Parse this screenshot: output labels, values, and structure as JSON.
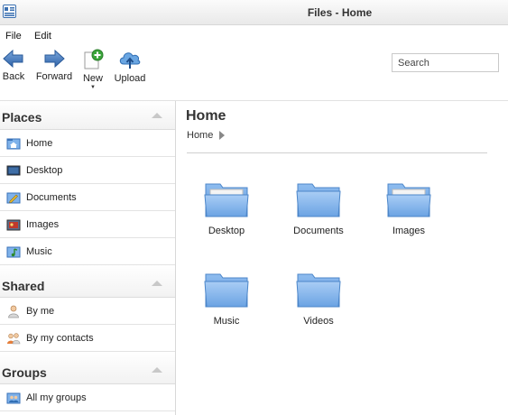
{
  "window": {
    "title": "Files - Home",
    "app_icon": "file-manager-icon"
  },
  "menu": [
    {
      "label": "File"
    },
    {
      "label": "Edit"
    }
  ],
  "toolbar": {
    "buttons": [
      {
        "label": "Back",
        "icon": "arrow-left-icon"
      },
      {
        "label": "Forward",
        "icon": "arrow-right-icon"
      },
      {
        "label": "New",
        "icon": "new-document-icon",
        "has_dropdown": true
      },
      {
        "label": "Upload",
        "icon": "cloud-upload-icon"
      }
    ],
    "search": {
      "placeholder": "Search",
      "value": ""
    }
  },
  "sidebar": {
    "places": {
      "title": "Places",
      "items": [
        {
          "label": "Home",
          "icon": "home-folder-icon"
        },
        {
          "label": "Desktop",
          "icon": "desktop-icon"
        },
        {
          "label": "Documents",
          "icon": "documents-icon"
        },
        {
          "label": "Images",
          "icon": "images-icon"
        },
        {
          "label": "Music",
          "icon": "music-icon"
        }
      ]
    },
    "shared": {
      "title": "Shared",
      "items": [
        {
          "label": "By me",
          "icon": "user-icon"
        },
        {
          "label": "By my contacts",
          "icon": "contacts-icon"
        }
      ]
    },
    "groups": {
      "title": "Groups",
      "items": [
        {
          "label": "All my groups",
          "icon": "groups-icon"
        }
      ]
    }
  },
  "main": {
    "title": "Home",
    "breadcrumb": [
      "Home"
    ],
    "folders": [
      {
        "label": "Desktop",
        "icon": "folder-icon"
      },
      {
        "label": "Documents",
        "icon": "folder-icon"
      },
      {
        "label": "Images",
        "icon": "folder-icon"
      },
      {
        "label": "Music",
        "icon": "folder-icon"
      },
      {
        "label": "Videos",
        "icon": "folder-icon"
      }
    ]
  },
  "colors": {
    "folder_blue": "#6fa8e6",
    "accent_blue": "#2f6db3",
    "title_bar": "#ececec"
  }
}
